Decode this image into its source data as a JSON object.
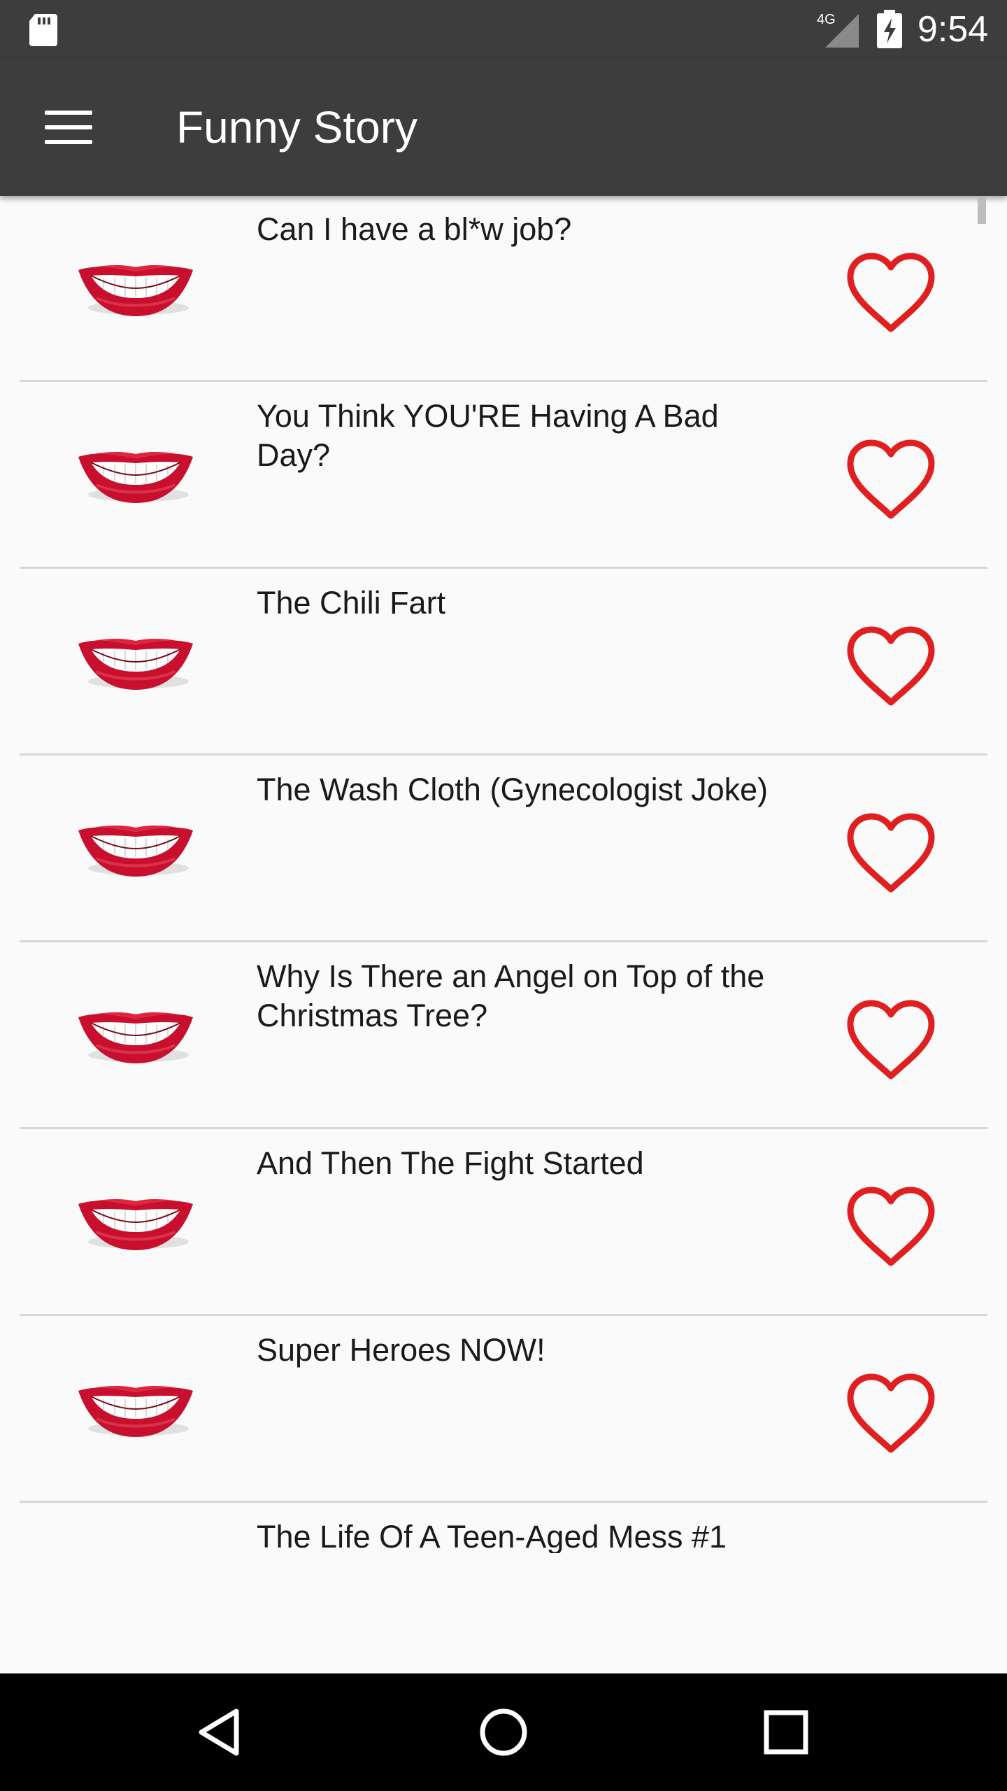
{
  "status_bar": {
    "time": "9:54",
    "network_label": "4G",
    "icons": [
      "sd-card-icon",
      "cell-signal-icon",
      "battery-charging-icon"
    ]
  },
  "app_bar": {
    "title": "Funny Story",
    "menu_icon": "hamburger-menu-icon"
  },
  "stories": [
    {
      "title": "Can I have a bl*w job?"
    },
    {
      "title": "You Think YOU'RE Having A Bad Day?"
    },
    {
      "title": "The Chili Fart"
    },
    {
      "title": "The Wash Cloth (Gynecologist Joke)"
    },
    {
      "title": "Why Is There an Angel on Top of the Christmas Tree?"
    },
    {
      "title": "And Then The Fight Started"
    },
    {
      "title": "Super Heroes NOW!"
    },
    {
      "title": "The Life Of A Teen-Aged Mess #1"
    }
  ],
  "row_icons": {
    "thumbnail": "lips-icon",
    "favorite": "heart-outline-icon"
  },
  "colors": {
    "app_bar": "#3d3d3d",
    "heart": "#e02020",
    "background": "#fafafa",
    "divider": "#d7d7d7"
  },
  "nav_bar": {
    "buttons": [
      "back-icon",
      "home-icon",
      "recents-icon"
    ]
  }
}
